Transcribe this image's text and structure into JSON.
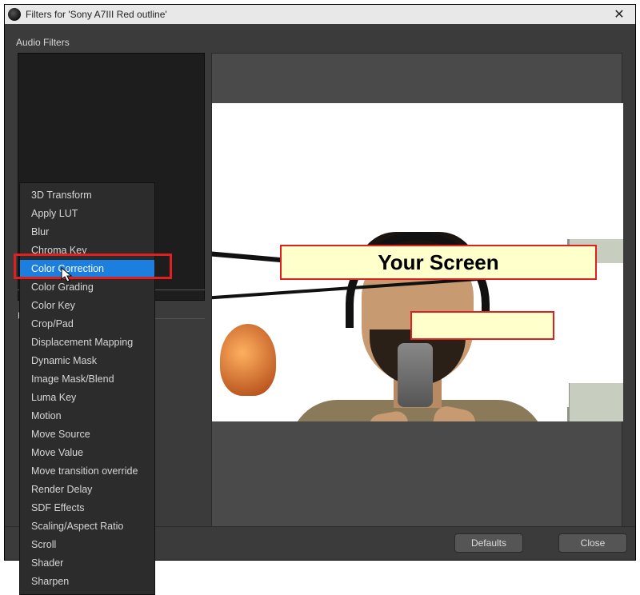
{
  "titlebar": {
    "title": "Filters for 'Sony A7III Red outline'"
  },
  "panel": {
    "audio_filters_label": "Audio Filters",
    "section_prefix": "E"
  },
  "context_menu": {
    "items": [
      "3D Transform",
      "Apply LUT",
      "Blur",
      "Chroma Key",
      "Color Correction",
      "Color Grading",
      "Color Key",
      "Crop/Pad",
      "Displacement Mapping",
      "Dynamic Mask",
      "Image Mask/Blend",
      "Luma Key",
      "Motion",
      "Move Source",
      "Move Value",
      "Move transition override",
      "Render Delay",
      "SDF Effects",
      "Scaling/Aspect Ratio",
      "Scroll",
      "Shader",
      "Sharpen"
    ],
    "selected_index": 4
  },
  "buttons": {
    "defaults": "Defaults",
    "close": "Close"
  },
  "annotations": {
    "your_screen": "Your Screen",
    "secondary": ""
  },
  "colors": {
    "selection": "#1c7fe0",
    "highlight": "#e02020",
    "callout_bg": "#ffffcc"
  }
}
